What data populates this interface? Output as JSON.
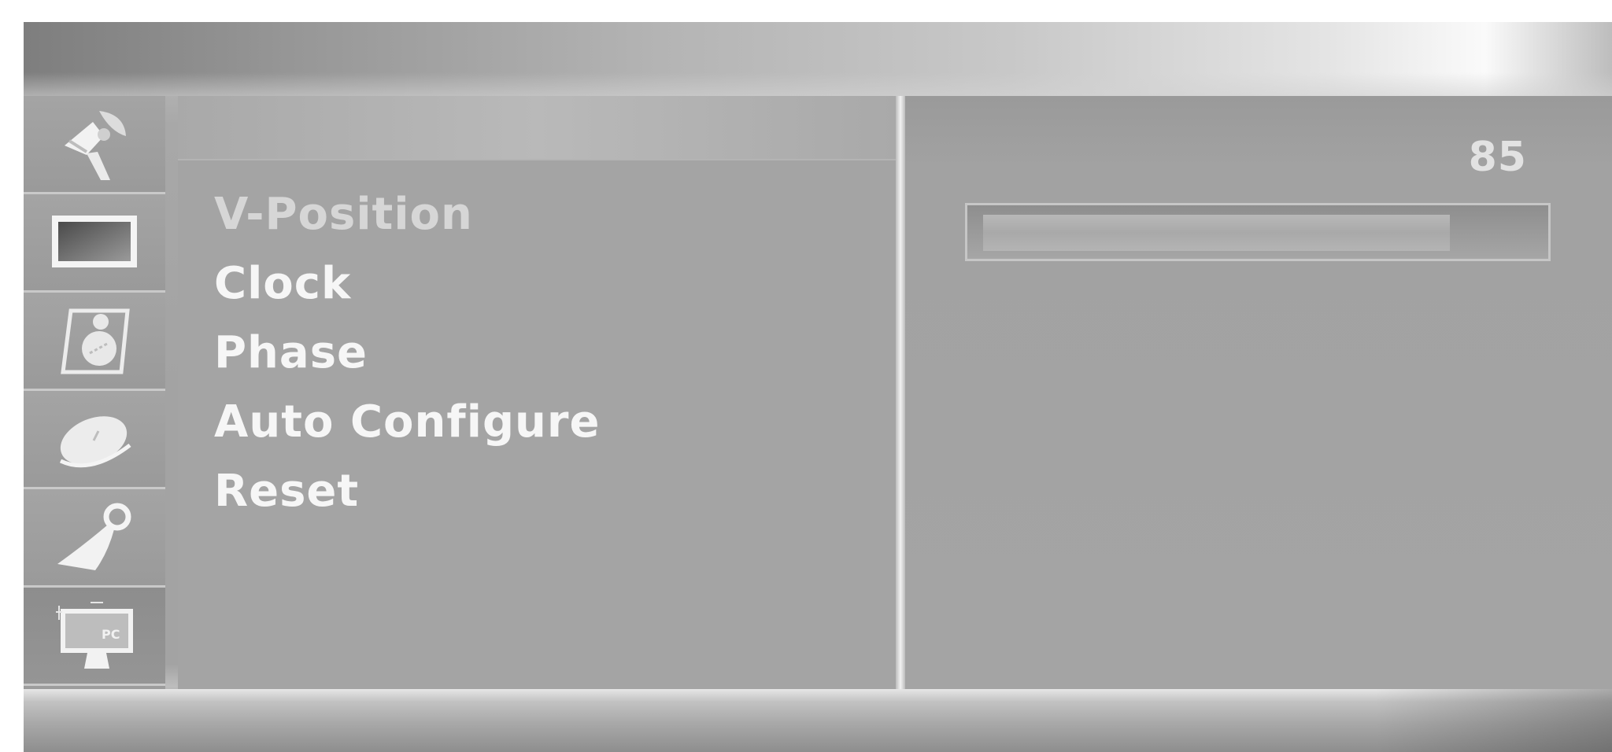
{
  "sidebar": {
    "items": [
      {
        "icon": "satellite-dish-icon"
      },
      {
        "icon": "picture-screen-icon"
      },
      {
        "icon": "audio-speaker-icon"
      },
      {
        "icon": "time-clock-icon"
      },
      {
        "icon": "lock-key-icon"
      },
      {
        "icon": "pc-monitor-icon"
      }
    ],
    "selected_index": 5
  },
  "menu": {
    "items": [
      {
        "label": "V-Position"
      },
      {
        "label": "Clock"
      },
      {
        "label": "Phase"
      },
      {
        "label": "Auto Configure"
      },
      {
        "label": "Reset"
      }
    ],
    "active_index": 0
  },
  "value_panel": {
    "value": "85",
    "slider_fraction": 0.85
  },
  "colors": {
    "panel": "#a4a4a4",
    "text": "#f6f6f6",
    "active_text": "#d6d6d6"
  }
}
